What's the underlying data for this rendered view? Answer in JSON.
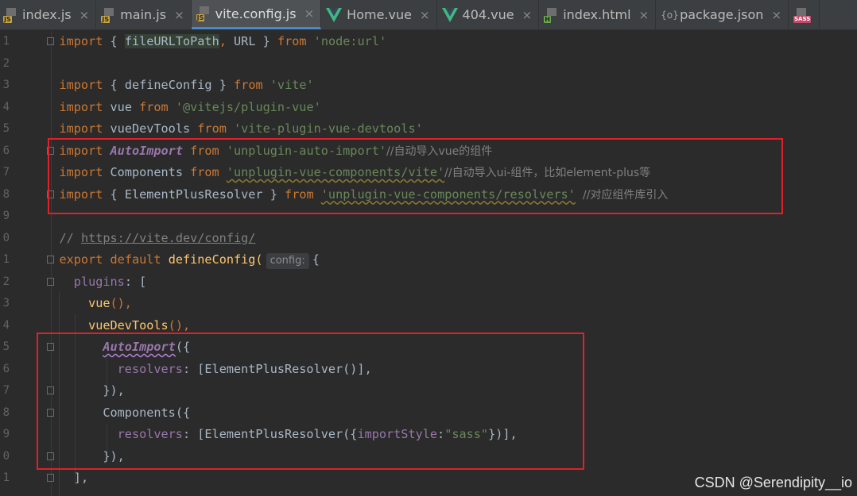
{
  "tabs": [
    {
      "label": "index.js",
      "icon": "js-file-icon",
      "badge": "JS"
    },
    {
      "label": "main.js",
      "icon": "js-file-icon",
      "badge": "JS"
    },
    {
      "label": "vite.config.js",
      "icon": "js-file-icon",
      "badge": "JS",
      "active": true
    },
    {
      "label": "Home.vue",
      "icon": "vue-file-icon"
    },
    {
      "label": "404.vue",
      "icon": "vue-file-icon"
    },
    {
      "label": "index.html",
      "icon": "html-file-icon",
      "badge": "H"
    },
    {
      "label": "package.json",
      "icon": "json-file-icon",
      "badge": "{o}"
    },
    {
      "label": "",
      "icon": "sass-file-icon",
      "badge": "SASS"
    }
  ],
  "close_glyph": "×",
  "line_numbers": [
    "1",
    "2",
    "3",
    "4",
    "5",
    "6",
    "7",
    "8",
    "9",
    "0",
    "1",
    "2",
    "3",
    "4",
    "5",
    "6",
    "7",
    "8",
    "9",
    "0",
    "1"
  ],
  "code": {
    "l1": [
      "import",
      "{",
      "fileURLToPath",
      ",",
      "URL",
      "}",
      "from",
      "'node:url'"
    ],
    "l3": [
      "import",
      "{",
      "defineConfig",
      "}",
      "from",
      "'vite'"
    ],
    "l4": [
      "import",
      "vue",
      "from",
      "'@vitejs/plugin-vue'"
    ],
    "l5": [
      "import",
      "vueDevTools",
      "from",
      "'vite-plugin-vue-devtools'"
    ],
    "l6": [
      "import",
      "AutoImport",
      "from",
      "'unplugin-auto-import'",
      "//自动导入vue的组件"
    ],
    "l7": [
      "import",
      "Components",
      "from",
      "'unplugin-vue-components/vite'",
      "//自动导入ui-组件，比如element-plus等"
    ],
    "l8": [
      "import",
      "{",
      "ElementPlusResolver",
      "}",
      "from",
      "'unplugin-vue-components/resolvers'",
      "//对应组件库引入"
    ],
    "l10": [
      "//",
      "https://vite.dev/config/"
    ],
    "l11": [
      "export",
      "default",
      "defineConfig(",
      "config:",
      "{"
    ],
    "l12": [
      "plugins",
      ":",
      "["
    ],
    "l13": [
      "vue",
      "(),"
    ],
    "l14": [
      "vueDevTools",
      "(),"
    ],
    "l15": [
      "AutoImport",
      "({"
    ],
    "l16": [
      "resolvers",
      ":",
      "[ElementPlusResolver()],"
    ],
    "l17": [
      "}),"
    ],
    "l18": [
      "Components",
      "({"
    ],
    "l19": [
      "resolvers",
      ":",
      "[ElementPlusResolver({",
      "importStyle",
      ":",
      "\"sass\"",
      "})],"
    ],
    "l20": [
      "}),"
    ],
    "l21": [
      "],"
    ]
  },
  "watermark": "CSDN @Serendipity__io",
  "colors": {
    "keyword": "#cc7832",
    "string": "#6a8759",
    "function": "#ffc66d",
    "property": "#9876aa",
    "highlight_box": "#e0202a"
  }
}
